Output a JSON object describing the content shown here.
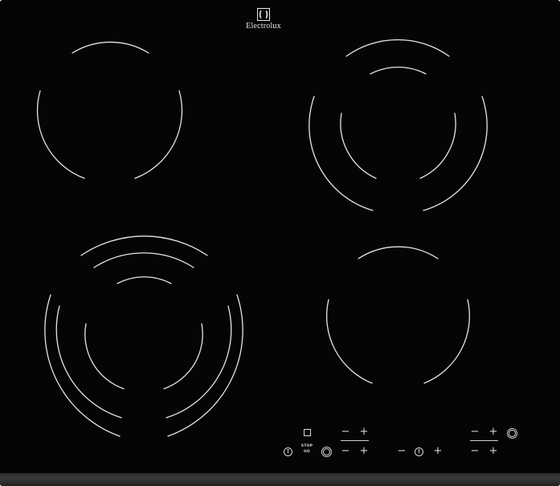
{
  "brand": {
    "name": "Electrolux",
    "logo_icon": "electrolux-logo-icon"
  },
  "cooking_zones": [
    {
      "id": "rear-left",
      "type": "single"
    },
    {
      "id": "rear-right",
      "type": "dual"
    },
    {
      "id": "front-left",
      "type": "triple"
    },
    {
      "id": "front-right",
      "type": "single"
    }
  ],
  "controls": {
    "minus_symbol": "−",
    "plus_symbol": "+",
    "stop_go_label_top": "STOP",
    "stop_go_label_bottom": "GO",
    "icons": [
      "lock-icon",
      "power-icon",
      "stop-go-icon",
      "zone-select-icon",
      "minus-icon",
      "plus-icon",
      "timer-icon"
    ]
  },
  "colors": {
    "glass": "#050505",
    "markings": "#e6e6e6",
    "trim": "#2f2f2f"
  }
}
